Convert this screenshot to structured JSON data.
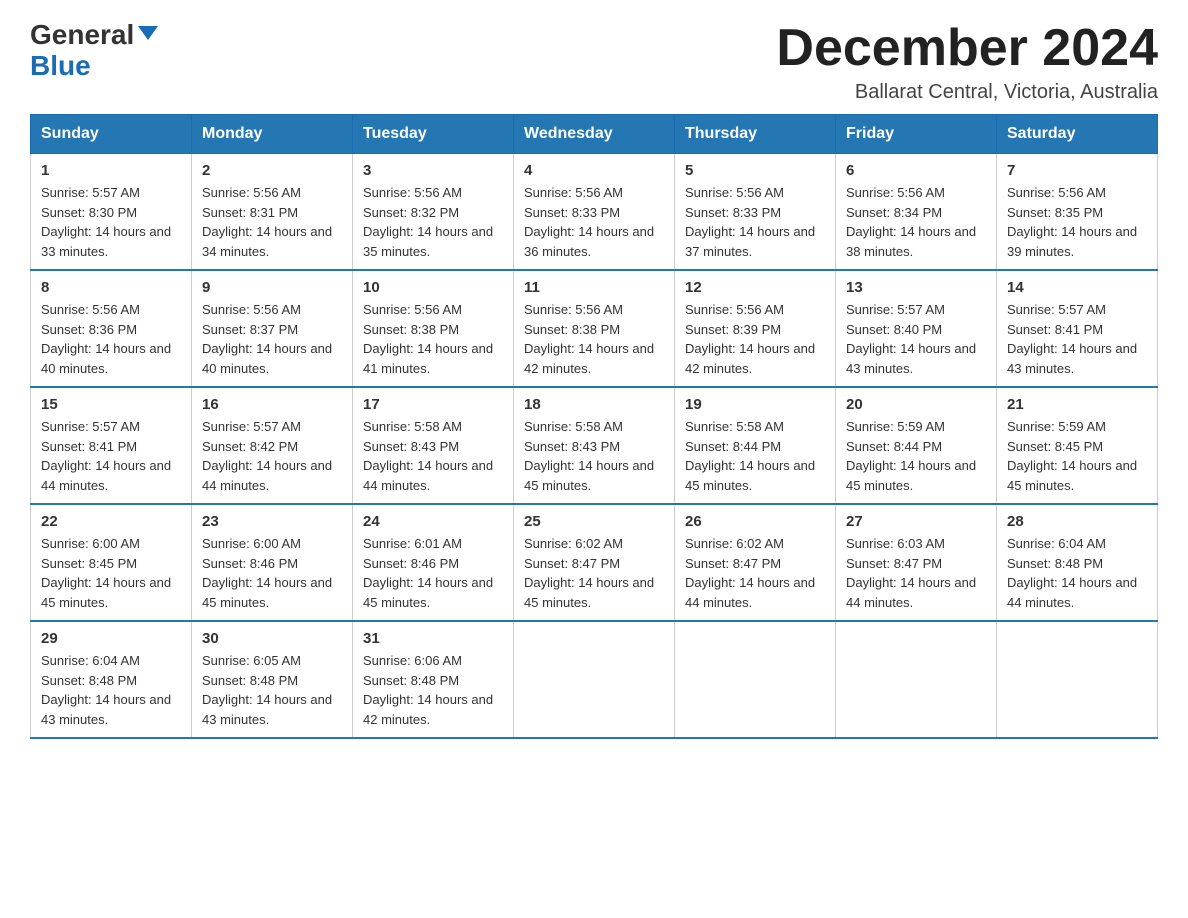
{
  "header": {
    "logo_general": "General",
    "logo_blue": "Blue",
    "month_title": "December 2024",
    "location": "Ballarat Central, Victoria, Australia"
  },
  "weekdays": [
    "Sunday",
    "Monday",
    "Tuesday",
    "Wednesday",
    "Thursday",
    "Friday",
    "Saturday"
  ],
  "weeks": [
    [
      {
        "day": "1",
        "sunrise": "5:57 AM",
        "sunset": "8:30 PM",
        "daylight": "14 hours and 33 minutes."
      },
      {
        "day": "2",
        "sunrise": "5:56 AM",
        "sunset": "8:31 PM",
        "daylight": "14 hours and 34 minutes."
      },
      {
        "day": "3",
        "sunrise": "5:56 AM",
        "sunset": "8:32 PM",
        "daylight": "14 hours and 35 minutes."
      },
      {
        "day": "4",
        "sunrise": "5:56 AM",
        "sunset": "8:33 PM",
        "daylight": "14 hours and 36 minutes."
      },
      {
        "day": "5",
        "sunrise": "5:56 AM",
        "sunset": "8:33 PM",
        "daylight": "14 hours and 37 minutes."
      },
      {
        "day": "6",
        "sunrise": "5:56 AM",
        "sunset": "8:34 PM",
        "daylight": "14 hours and 38 minutes."
      },
      {
        "day": "7",
        "sunrise": "5:56 AM",
        "sunset": "8:35 PM",
        "daylight": "14 hours and 39 minutes."
      }
    ],
    [
      {
        "day": "8",
        "sunrise": "5:56 AM",
        "sunset": "8:36 PM",
        "daylight": "14 hours and 40 minutes."
      },
      {
        "day": "9",
        "sunrise": "5:56 AM",
        "sunset": "8:37 PM",
        "daylight": "14 hours and 40 minutes."
      },
      {
        "day": "10",
        "sunrise": "5:56 AM",
        "sunset": "8:38 PM",
        "daylight": "14 hours and 41 minutes."
      },
      {
        "day": "11",
        "sunrise": "5:56 AM",
        "sunset": "8:38 PM",
        "daylight": "14 hours and 42 minutes."
      },
      {
        "day": "12",
        "sunrise": "5:56 AM",
        "sunset": "8:39 PM",
        "daylight": "14 hours and 42 minutes."
      },
      {
        "day": "13",
        "sunrise": "5:57 AM",
        "sunset": "8:40 PM",
        "daylight": "14 hours and 43 minutes."
      },
      {
        "day": "14",
        "sunrise": "5:57 AM",
        "sunset": "8:41 PM",
        "daylight": "14 hours and 43 minutes."
      }
    ],
    [
      {
        "day": "15",
        "sunrise": "5:57 AM",
        "sunset": "8:41 PM",
        "daylight": "14 hours and 44 minutes."
      },
      {
        "day": "16",
        "sunrise": "5:57 AM",
        "sunset": "8:42 PM",
        "daylight": "14 hours and 44 minutes."
      },
      {
        "day": "17",
        "sunrise": "5:58 AM",
        "sunset": "8:43 PM",
        "daylight": "14 hours and 44 minutes."
      },
      {
        "day": "18",
        "sunrise": "5:58 AM",
        "sunset": "8:43 PM",
        "daylight": "14 hours and 45 minutes."
      },
      {
        "day": "19",
        "sunrise": "5:58 AM",
        "sunset": "8:44 PM",
        "daylight": "14 hours and 45 minutes."
      },
      {
        "day": "20",
        "sunrise": "5:59 AM",
        "sunset": "8:44 PM",
        "daylight": "14 hours and 45 minutes."
      },
      {
        "day": "21",
        "sunrise": "5:59 AM",
        "sunset": "8:45 PM",
        "daylight": "14 hours and 45 minutes."
      }
    ],
    [
      {
        "day": "22",
        "sunrise": "6:00 AM",
        "sunset": "8:45 PM",
        "daylight": "14 hours and 45 minutes."
      },
      {
        "day": "23",
        "sunrise": "6:00 AM",
        "sunset": "8:46 PM",
        "daylight": "14 hours and 45 minutes."
      },
      {
        "day": "24",
        "sunrise": "6:01 AM",
        "sunset": "8:46 PM",
        "daylight": "14 hours and 45 minutes."
      },
      {
        "day": "25",
        "sunrise": "6:02 AM",
        "sunset": "8:47 PM",
        "daylight": "14 hours and 45 minutes."
      },
      {
        "day": "26",
        "sunrise": "6:02 AM",
        "sunset": "8:47 PM",
        "daylight": "14 hours and 44 minutes."
      },
      {
        "day": "27",
        "sunrise": "6:03 AM",
        "sunset": "8:47 PM",
        "daylight": "14 hours and 44 minutes."
      },
      {
        "day": "28",
        "sunrise": "6:04 AM",
        "sunset": "8:48 PM",
        "daylight": "14 hours and 44 minutes."
      }
    ],
    [
      {
        "day": "29",
        "sunrise": "6:04 AM",
        "sunset": "8:48 PM",
        "daylight": "14 hours and 43 minutes."
      },
      {
        "day": "30",
        "sunrise": "6:05 AM",
        "sunset": "8:48 PM",
        "daylight": "14 hours and 43 minutes."
      },
      {
        "day": "31",
        "sunrise": "6:06 AM",
        "sunset": "8:48 PM",
        "daylight": "14 hours and 42 minutes."
      },
      null,
      null,
      null,
      null
    ]
  ]
}
